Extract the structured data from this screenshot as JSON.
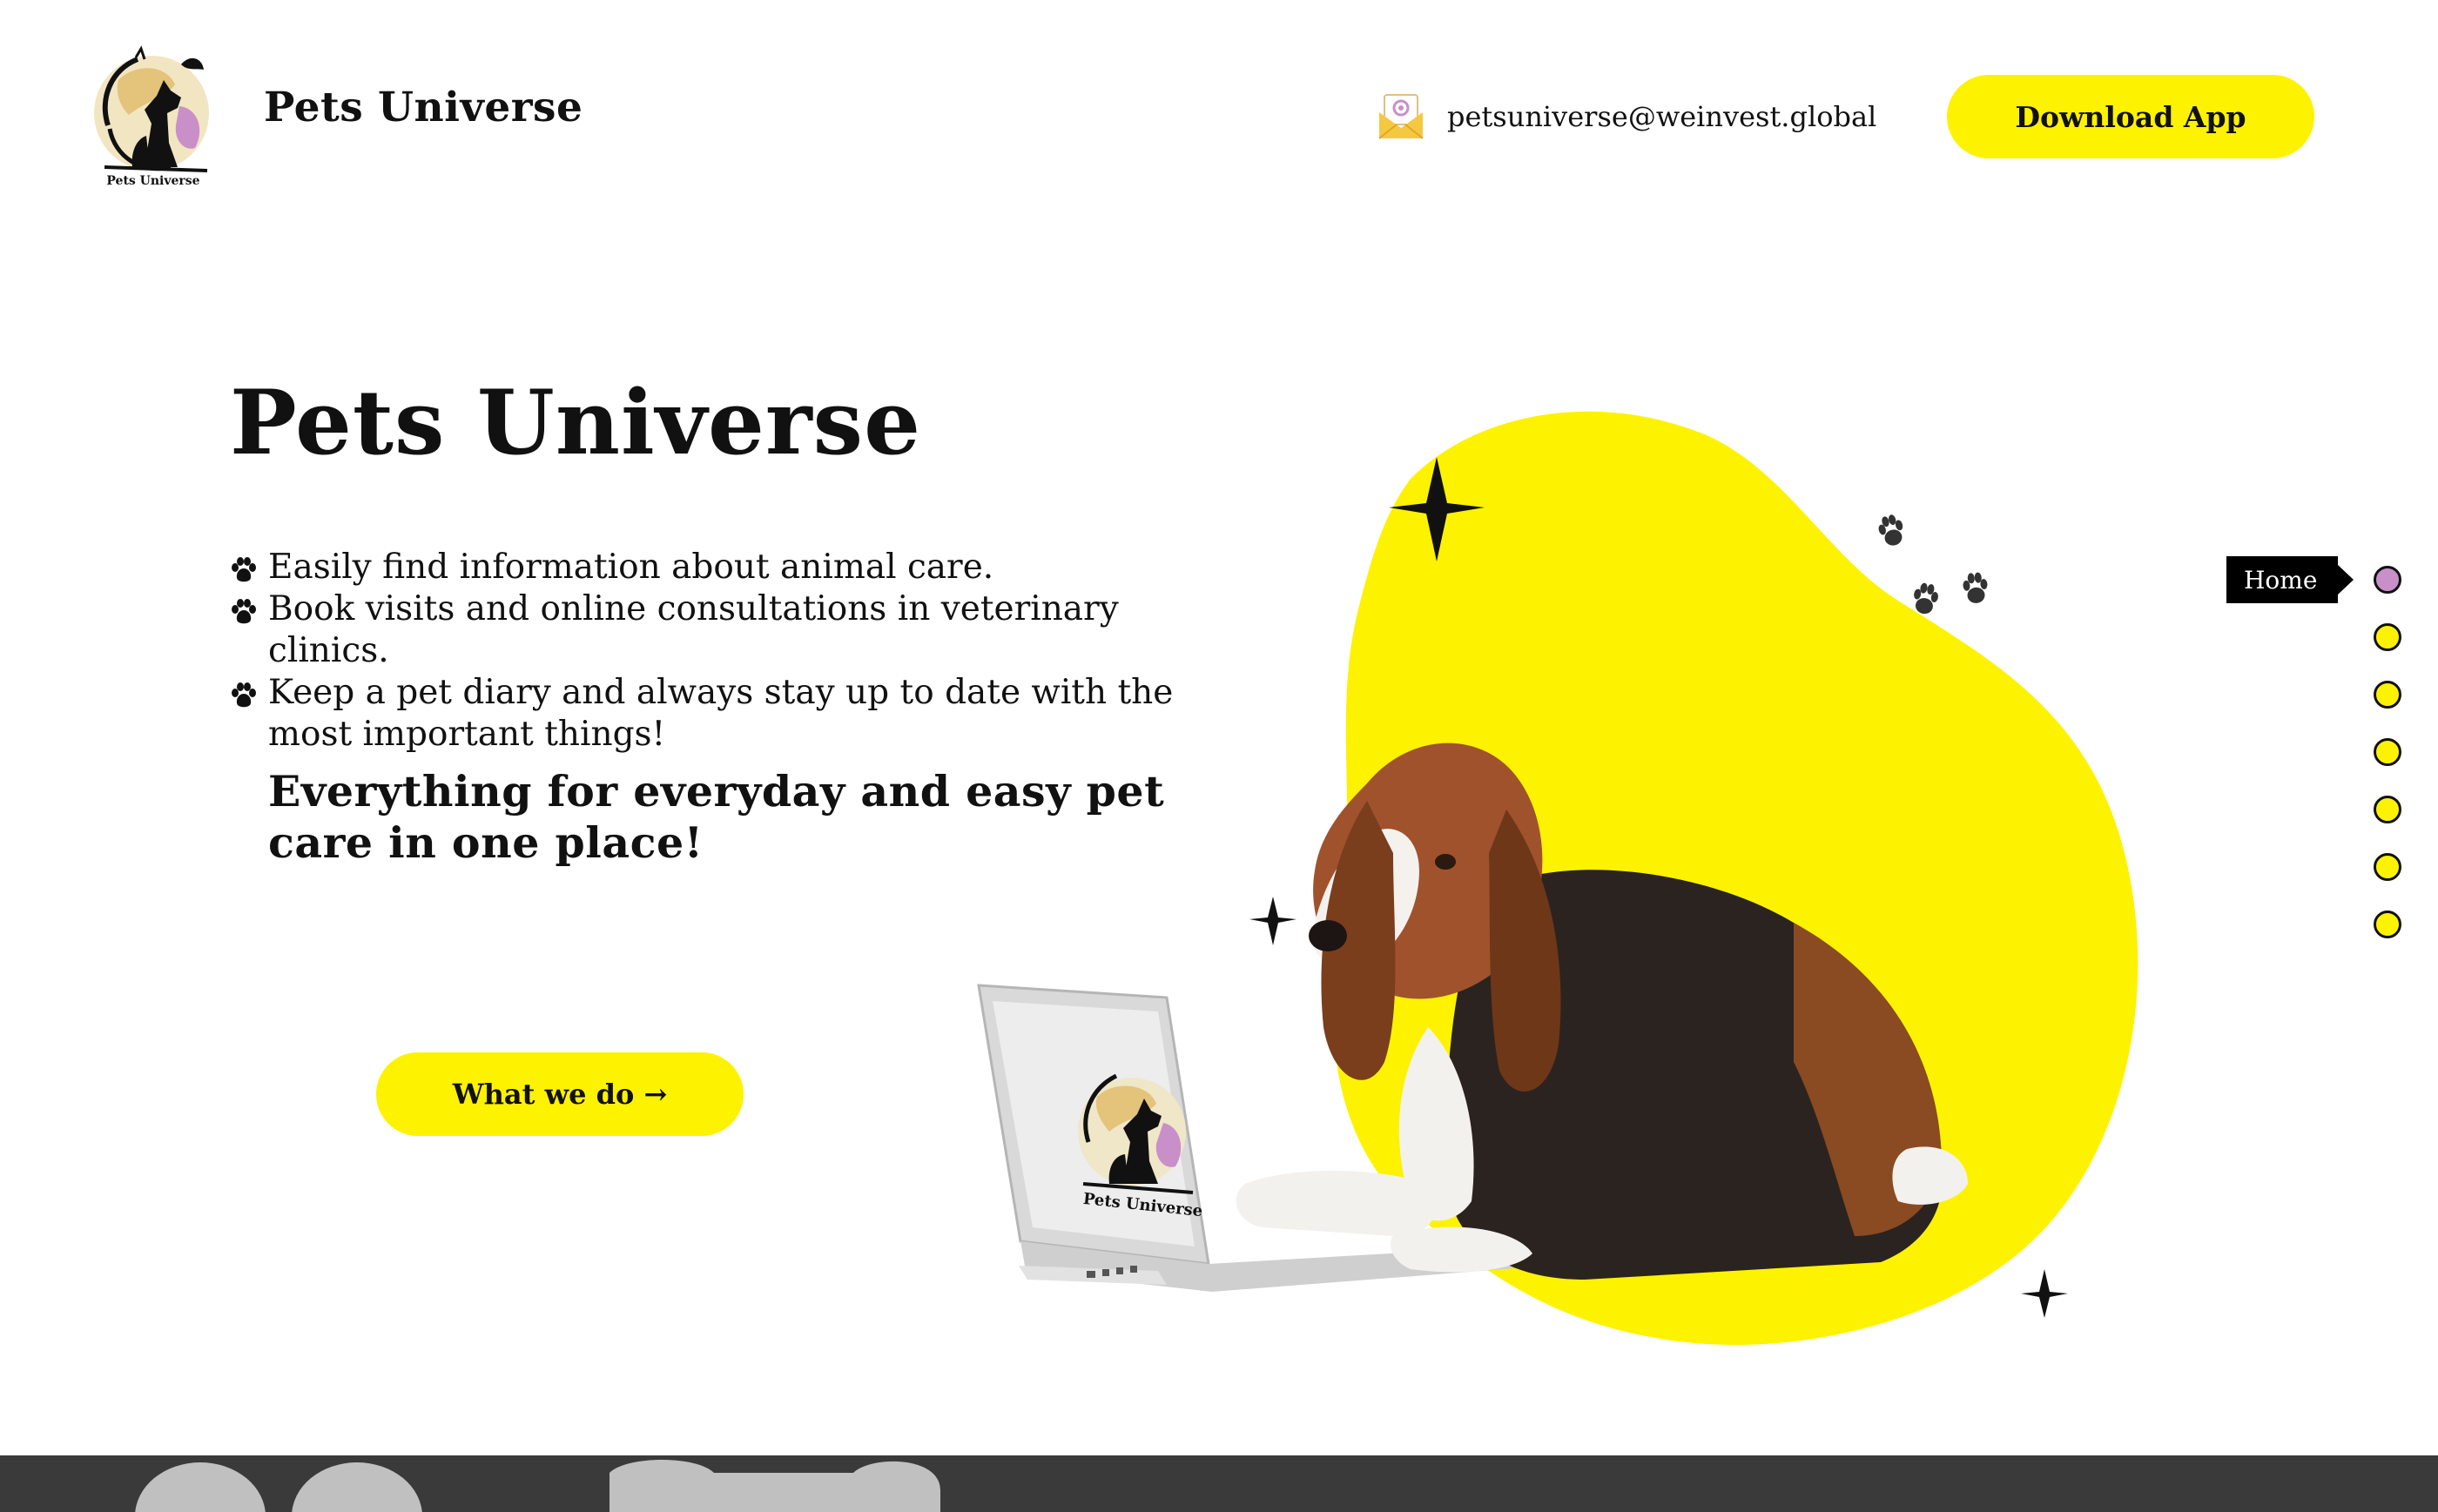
{
  "header": {
    "brand_name": "Pets Universe",
    "logo_text": "Pets Universe",
    "contact_email": "petsuniverse@weinvest.global",
    "download_button": "Download App"
  },
  "hero": {
    "title": "Pets Universe",
    "features": [
      "Easily find information about animal care.",
      "Book visits and online consultations in veterinary clinics.",
      "Keep a pet diary and always stay up to date with the most important things!"
    ],
    "tagline": "Everything for everyday and easy pet care in one place!",
    "cta_button": "What we do →",
    "laptop_logo_text": "Pets Universe"
  },
  "section_nav": {
    "active_label": "Home",
    "dot_count": 7,
    "active_index": 0
  },
  "colors": {
    "accent_yellow": "#fdf200",
    "active_dot_pink": "#c98fc9",
    "text_dark": "#111111",
    "footer_dark": "#3a3a3a"
  },
  "icons": {
    "contact": "mail-envelope-icon",
    "bullets": "paw-icon",
    "decor": "sparkle-icon"
  }
}
